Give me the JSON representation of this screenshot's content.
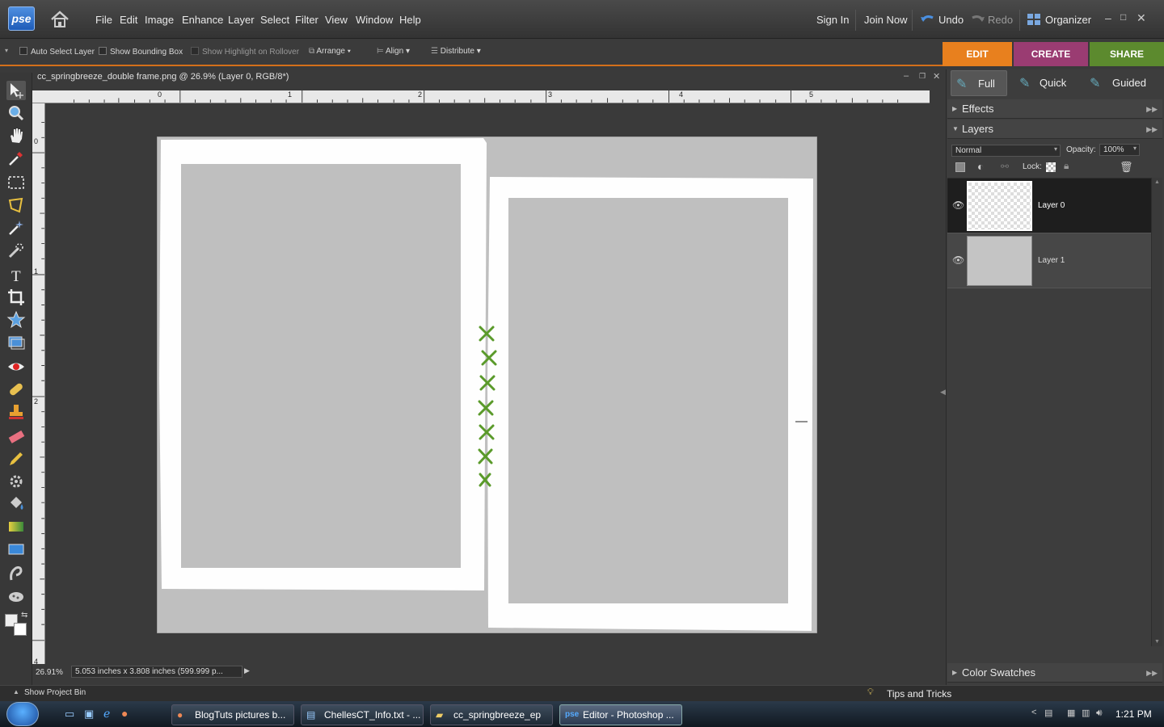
{
  "app": {
    "logo_text": "pse",
    "menus": [
      "File",
      "Edit",
      "Image",
      "Enhance",
      "Layer",
      "Select",
      "Filter",
      "View",
      "Window",
      "Help"
    ],
    "sign_in": "Sign In",
    "join_now": "Join Now",
    "undo": "Undo",
    "redo": "Redo",
    "organizer": "Organizer"
  },
  "options": {
    "auto_select": "Auto Select Layer",
    "bounding_box": "Show Bounding Box",
    "highlight": "Show Highlight on Rollover",
    "arrange": "Arrange",
    "align": "Align",
    "distribute": "Distribute"
  },
  "modes": {
    "edit": "EDIT",
    "create": "CREATE",
    "share": "SHARE",
    "edit_color": "#e8801e",
    "create_color": "#9a3c72",
    "share_color": "#5c8a2e"
  },
  "edit_tabs": [
    "Full",
    "Quick",
    "Guided"
  ],
  "document": {
    "title": "cc_springbreeze_double frame.png @ 26.9% (Layer 0, RGB/8*)",
    "zoom": "26.91%",
    "size_info": "5.053 inches x 3.808 inches (599.999 p...",
    "ruler_h_labels": [
      "0",
      "1",
      "2",
      "3",
      "4",
      "5"
    ],
    "ruler_v_labels": [
      "0",
      "1",
      "2",
      "4"
    ]
  },
  "panels": {
    "effects": "Effects",
    "layers": "Layers",
    "blend_mode": "Normal",
    "opacity_label": "Opacity:",
    "opacity_value": "100%",
    "lock_label": "Lock:",
    "layers_list": [
      {
        "name": "Layer 0",
        "selected": true
      },
      {
        "name": "Layer 1",
        "selected": false
      }
    ],
    "color_swatches": "Color Swatches"
  },
  "bottom": {
    "project_bin": "Show Project Bin",
    "tips": "Tips and Tricks"
  },
  "taskbar": {
    "items": [
      "BlogTuts pictures b...",
      "ChellesCT_Info.txt - ...",
      "cc_springbreeze_ep",
      "Editor - Photoshop ..."
    ],
    "clock": "1:21 PM"
  }
}
